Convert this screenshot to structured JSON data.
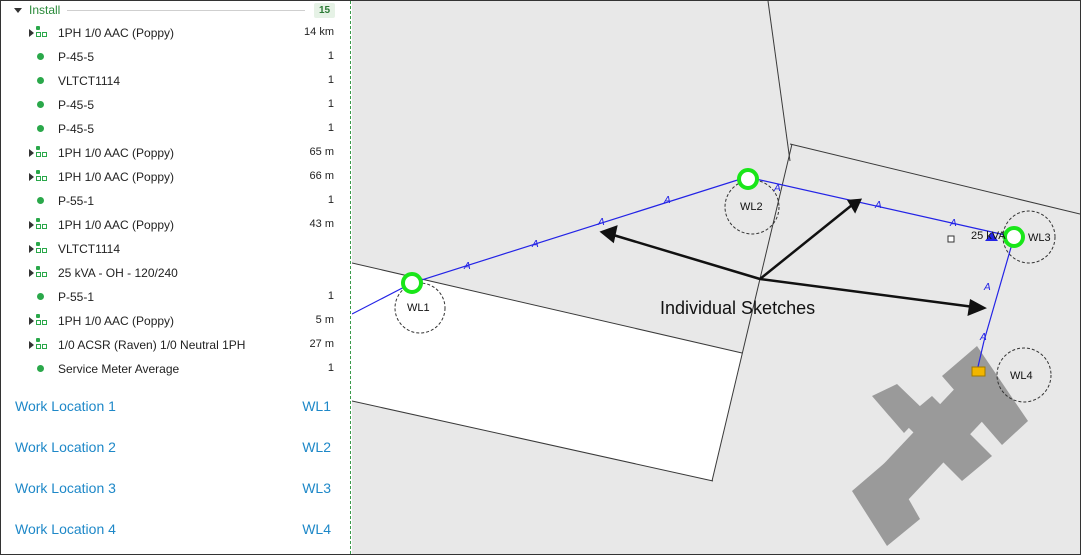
{
  "install_group": {
    "label": "Install",
    "count": "15",
    "items": [
      {
        "label": "1PH 1/0 AAC (Poppy)",
        "value": "14 km",
        "kind": "group",
        "expandable": true
      },
      {
        "label": "P-45-5",
        "value": "1",
        "kind": "point",
        "expandable": false
      },
      {
        "label": "VLTCT1114",
        "value": "1",
        "kind": "point",
        "expandable": false
      },
      {
        "label": "P-45-5",
        "value": "1",
        "kind": "point",
        "expandable": false
      },
      {
        "label": "P-45-5",
        "value": "1",
        "kind": "point",
        "expandable": false
      },
      {
        "label": "1PH 1/0 AAC (Poppy)",
        "value": "65 m",
        "kind": "group",
        "expandable": true
      },
      {
        "label": "1PH 1/0 AAC (Poppy)",
        "value": "66 m",
        "kind": "group",
        "expandable": true
      },
      {
        "label": "P-55-1",
        "value": "1",
        "kind": "point",
        "expandable": false
      },
      {
        "label": "1PH 1/0 AAC (Poppy)",
        "value": "43 m",
        "kind": "group",
        "expandable": true
      },
      {
        "label": "VLTCT1114",
        "value": "",
        "kind": "group",
        "expandable": true
      },
      {
        "label": "25 kVA - OH - 120/240",
        "value": "",
        "kind": "group",
        "expandable": true
      },
      {
        "label": "P-55-1",
        "value": "1",
        "kind": "point",
        "expandable": false
      },
      {
        "label": "1PH 1/0 AAC (Poppy)",
        "value": "5 m",
        "kind": "group",
        "expandable": true
      },
      {
        "label": "1/0 ACSR (Raven) 1/0 Neutral 1PH",
        "value": "27 m",
        "kind": "group",
        "expandable": true
      },
      {
        "label": "Service Meter Average",
        "value": "1",
        "kind": "point",
        "expandable": false
      }
    ]
  },
  "work_locations": [
    {
      "name": "Work Location 1",
      "code": "WL1"
    },
    {
      "name": "Work Location 2",
      "code": "WL2"
    },
    {
      "name": "Work Location 3",
      "code": "WL3"
    },
    {
      "name": "Work Location 4",
      "code": "WL4"
    }
  ],
  "map": {
    "callout": "Individual Sketches",
    "transformer_label": "25 kVA",
    "sketch_labels": [
      "WL1",
      "WL2",
      "WL3",
      "WL4"
    ],
    "colors": {
      "line": "#2323e6",
      "node_ring": "#19e619",
      "parcel": "#e8e8e8",
      "road": "#ffffff",
      "building": "#9a9a9a",
      "meter": "#f2b600"
    }
  }
}
